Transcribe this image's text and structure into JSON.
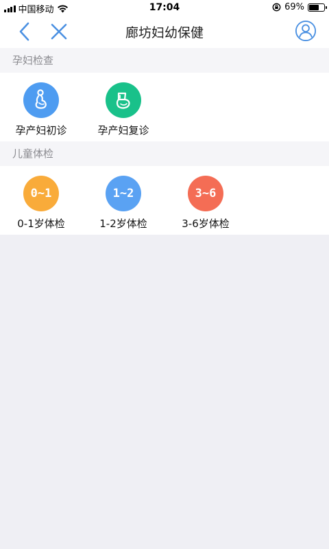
{
  "status": {
    "carrier": "中国移动",
    "time": "17:04",
    "battery_text": "69%",
    "battery_level": 0.69
  },
  "nav": {
    "title": "廊坊妇幼保健",
    "back_icon": "chevron-left-icon",
    "close_icon": "close-icon",
    "profile_icon": "user-circle-icon",
    "accent": "#4a90e2"
  },
  "sections": [
    {
      "header": "孕妇检查",
      "items": [
        {
          "label": "孕产妇初诊",
          "icon": "pregnant-woman-icon",
          "color": "#4e9cf1"
        },
        {
          "label": "孕产妇复诊",
          "icon": "pregnancy-checkup-icon",
          "color": "#19c18a"
        }
      ]
    },
    {
      "header": "儿童体检",
      "items": [
        {
          "label": "0-1岁体检",
          "icon_text": "0~1",
          "color": "#f9ab3a"
        },
        {
          "label": "1-2岁体检",
          "icon_text": "1~2",
          "color": "#5aa2f3"
        },
        {
          "label": "3-6岁体检",
          "icon_text": "3~6",
          "color": "#f46d55"
        }
      ]
    }
  ]
}
